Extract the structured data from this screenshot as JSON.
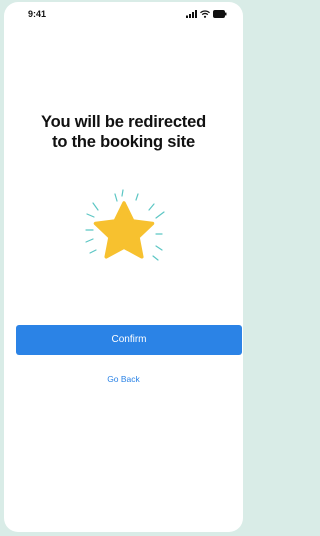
{
  "status_bar": {
    "time": "9:41",
    "icons": [
      "signal-icon",
      "wifi-icon",
      "battery-icon"
    ]
  },
  "main": {
    "headline_line1": "You will be redirected",
    "headline_line2": "to the booking site",
    "illustration_icon": "sparkling-star-icon"
  },
  "actions": {
    "confirm_label": "Confirm",
    "go_back_label": "Go Back"
  },
  "colors": {
    "background": "#d9ece7",
    "accent": "#2b83e6",
    "star": "#f7c12f",
    "sparkle": "#5cc6c4",
    "text": "#111111"
  }
}
